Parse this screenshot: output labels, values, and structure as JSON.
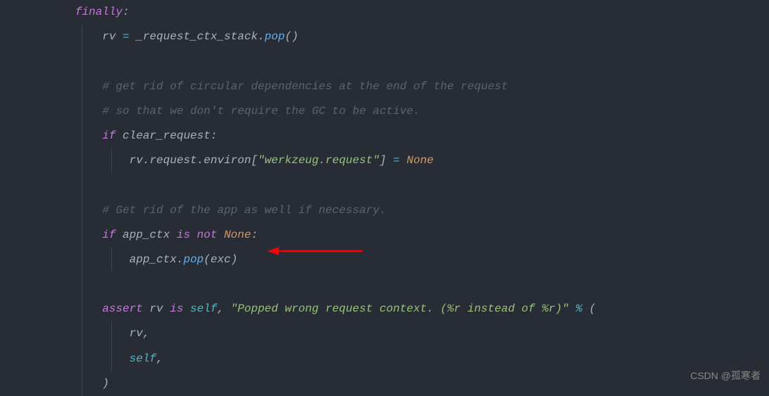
{
  "code": {
    "lines": [
      {
        "indent": 2,
        "tokens": [
          {
            "t": "finally",
            "c": "kw"
          },
          {
            "t": ":",
            "c": "punct"
          }
        ]
      },
      {
        "indent": 3,
        "tokens": [
          {
            "t": "rv ",
            "c": "var"
          },
          {
            "t": "=",
            "c": "op"
          },
          {
            "t": " _request_ctx_stack",
            "c": "var"
          },
          {
            "t": ".",
            "c": "punct"
          },
          {
            "t": "pop",
            "c": "fn"
          },
          {
            "t": "()",
            "c": "paren"
          }
        ]
      },
      {
        "indent": 3,
        "tokens": []
      },
      {
        "indent": 3,
        "tokens": [
          {
            "t": "# get rid of circular dependencies at the end of the request",
            "c": "comment"
          }
        ]
      },
      {
        "indent": 3,
        "tokens": [
          {
            "t": "# so that we don't require the GC to be active.",
            "c": "comment"
          }
        ]
      },
      {
        "indent": 3,
        "tokens": [
          {
            "t": "if",
            "c": "kw"
          },
          {
            "t": " clear_request",
            "c": "var"
          },
          {
            "t": ":",
            "c": "punct"
          }
        ]
      },
      {
        "indent": 4,
        "tokens": [
          {
            "t": "rv",
            "c": "var"
          },
          {
            "t": ".",
            "c": "punct"
          },
          {
            "t": "request",
            "c": "var"
          },
          {
            "t": ".",
            "c": "punct"
          },
          {
            "t": "environ",
            "c": "var"
          },
          {
            "t": "[",
            "c": "paren"
          },
          {
            "t": "\"werkzeug.request\"",
            "c": "str"
          },
          {
            "t": "]",
            "c": "paren"
          },
          {
            "t": " ",
            "c": "var"
          },
          {
            "t": "=",
            "c": "op"
          },
          {
            "t": " ",
            "c": "var"
          },
          {
            "t": "None",
            "c": "none"
          }
        ]
      },
      {
        "indent": 3,
        "tokens": []
      },
      {
        "indent": 3,
        "tokens": [
          {
            "t": "# Get rid of the app as well if necessary.",
            "c": "comment"
          }
        ]
      },
      {
        "indent": 3,
        "tokens": [
          {
            "t": "if",
            "c": "kw"
          },
          {
            "t": " app_ctx ",
            "c": "var"
          },
          {
            "t": "is",
            "c": "kw"
          },
          {
            "t": " ",
            "c": "var"
          },
          {
            "t": "not",
            "c": "kw"
          },
          {
            "t": " ",
            "c": "var"
          },
          {
            "t": "None",
            "c": "none"
          },
          {
            "t": ":",
            "c": "punct"
          }
        ]
      },
      {
        "indent": 4,
        "tokens": [
          {
            "t": "app_ctx",
            "c": "var"
          },
          {
            "t": ".",
            "c": "punct"
          },
          {
            "t": "pop",
            "c": "fn"
          },
          {
            "t": "(",
            "c": "paren"
          },
          {
            "t": "exc",
            "c": "var"
          },
          {
            "t": ")",
            "c": "paren"
          }
        ]
      },
      {
        "indent": 3,
        "tokens": []
      },
      {
        "indent": 3,
        "tokens": [
          {
            "t": "assert",
            "c": "kw"
          },
          {
            "t": " rv ",
            "c": "var"
          },
          {
            "t": "is",
            "c": "kw"
          },
          {
            "t": " ",
            "c": "var"
          },
          {
            "t": "self",
            "c": "builtin"
          },
          {
            "t": ", ",
            "c": "punct"
          },
          {
            "t": "\"Popped wrong request context. (%r instead of %r)\"",
            "c": "str"
          },
          {
            "t": " ",
            "c": "var"
          },
          {
            "t": "%",
            "c": "op"
          },
          {
            "t": " (",
            "c": "paren"
          }
        ]
      },
      {
        "indent": 4,
        "tokens": [
          {
            "t": "rv",
            "c": "var"
          },
          {
            "t": ",",
            "c": "punct"
          }
        ]
      },
      {
        "indent": 4,
        "tokens": [
          {
            "t": "self",
            "c": "builtin"
          },
          {
            "t": ",",
            "c": "punct"
          }
        ]
      },
      {
        "indent": 3,
        "tokens": [
          {
            "t": ")",
            "c": "paren"
          }
        ]
      }
    ]
  },
  "annotation": {
    "type": "arrow",
    "color": "#ff0000"
  },
  "watermark": "CSDN @孤寒者"
}
